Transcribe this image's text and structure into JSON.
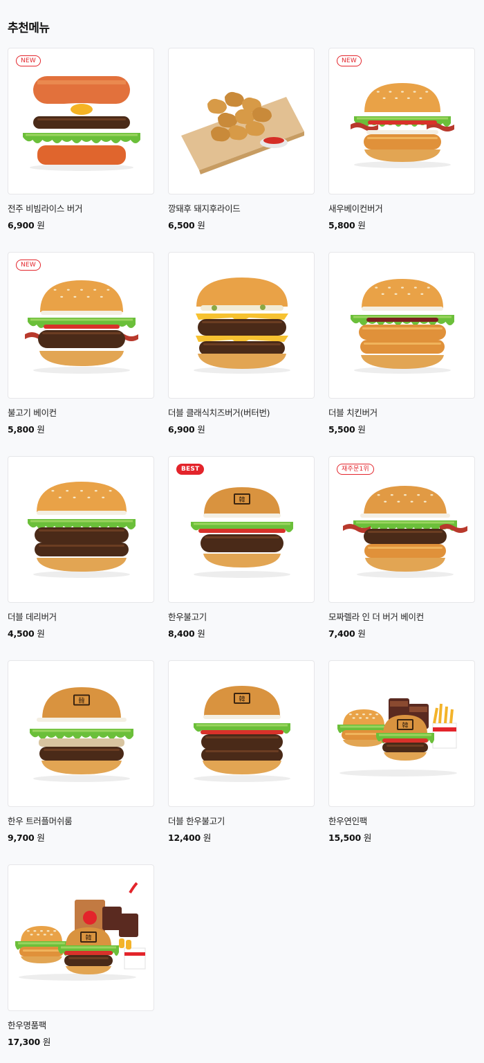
{
  "section": {
    "title": "추천메뉴"
  },
  "currency": "원",
  "items": [
    {
      "name": "전주 비빔라이스 버거",
      "price": "6,900",
      "badge": "NEW",
      "badge_style": "outline",
      "image": "rice-burger"
    },
    {
      "name": "깡돼후 돼지후라이드",
      "price": "6,500",
      "badge": "",
      "badge_style": "",
      "image": "fried-pork"
    },
    {
      "name": "새우베이컨버거",
      "price": "5,800",
      "badge": "NEW",
      "badge_style": "outline",
      "image": "shrimp-bacon-burger"
    },
    {
      "name": "불고기 베이컨",
      "price": "5,800",
      "badge": "NEW",
      "badge_style": "outline",
      "image": "bulgogi-bacon-burger"
    },
    {
      "name": "더블 클래식치즈버거(버터번)",
      "price": "6,900",
      "badge": "",
      "badge_style": "",
      "image": "double-cheese-burger"
    },
    {
      "name": "더블 치킨버거",
      "price": "5,500",
      "badge": "",
      "badge_style": "",
      "image": "double-chicken-burger"
    },
    {
      "name": "더블 데리버거",
      "price": "4,500",
      "badge": "",
      "badge_style": "",
      "image": "double-teri-burger"
    },
    {
      "name": "한우불고기",
      "price": "8,400",
      "badge": "BEST",
      "badge_style": "fill",
      "image": "hanwoo-bulgogi-burger"
    },
    {
      "name": "모짜렐라 인 더 버거 베이컨",
      "price": "7,400",
      "badge": "재주문1위",
      "badge_style": "outline",
      "image": "mozzarella-burger"
    },
    {
      "name": "한우 트러플머쉬룸",
      "price": "9,700",
      "badge": "",
      "badge_style": "",
      "image": "hanwoo-truffle-burger"
    },
    {
      "name": "더블 한우불고기",
      "price": "12,400",
      "badge": "",
      "badge_style": "",
      "image": "double-hanwoo-burger"
    },
    {
      "name": "한우연인팩",
      "price": "15,500",
      "badge": "",
      "badge_style": "",
      "image": "hanwoo-couple-pack"
    },
    {
      "name": "한우명품팩",
      "price": "17,300",
      "badge": "",
      "badge_style": "",
      "image": "hanwoo-premium-pack"
    }
  ],
  "colors": {
    "accent": "#e3242b",
    "background": "#f8f9fb",
    "card_border": "#e6e6e9"
  }
}
